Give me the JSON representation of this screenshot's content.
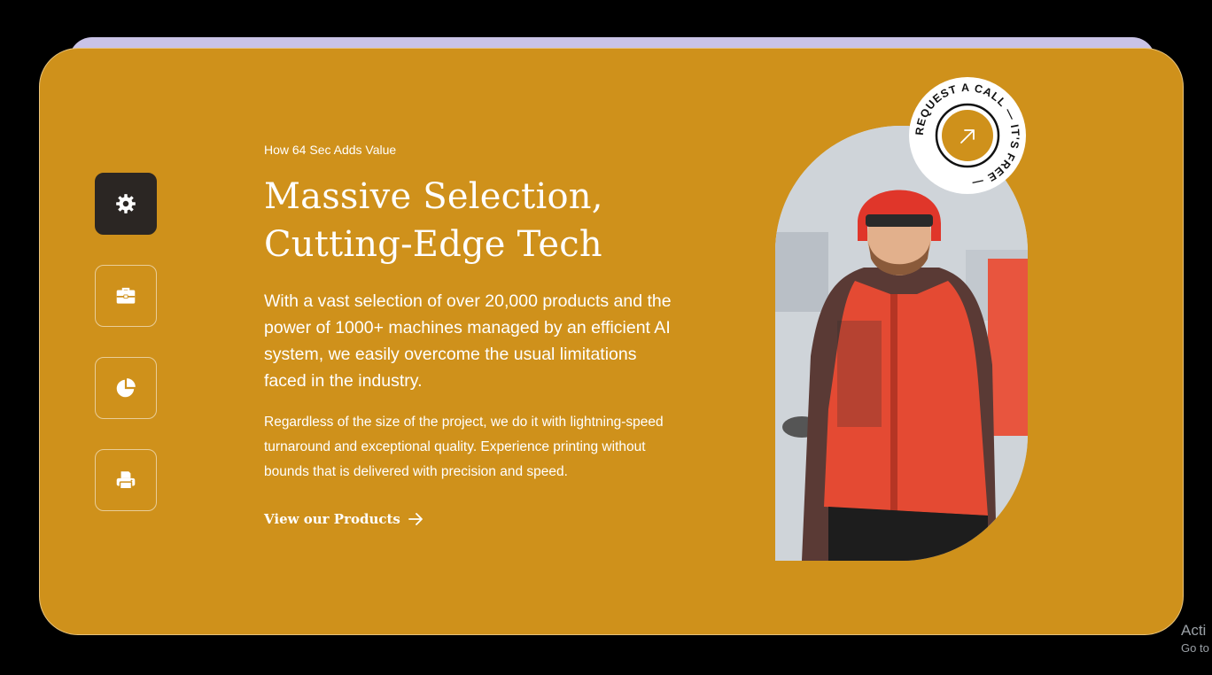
{
  "section": {
    "eyebrow": "How 64 Sec Adds Value",
    "headline_line1": "Massive Selection,",
    "headline_line2": "Cutting-Edge Tech",
    "lead": "With a vast selection of over 20,000 products and the power of 1000+ machines managed by an efficient AI system, we easily overcome the usual limitations faced in the industry.",
    "body": "Regardless of the size of the project, we do it with lightning-speed turnaround and exceptional quality. Experience printing without bounds that is delivered with precision and speed.",
    "cta_label": "View our Products"
  },
  "tabs": [
    {
      "icon": "gear-icon",
      "active": true
    },
    {
      "icon": "briefcase-icon",
      "active": false
    },
    {
      "icon": "pie-chart-icon",
      "active": false
    },
    {
      "icon": "printer-icon",
      "active": false
    }
  ],
  "badge": {
    "text": "REQUEST A CALL — IT'S FREE —",
    "icon": "arrow-up-right-icon"
  },
  "watermark": {
    "line1": "Acti",
    "line2": "Go to"
  },
  "colors": {
    "card_bg": "#cf911b",
    "active_tab_bg": "#2b2623",
    "text": "#ffffff",
    "back_card": "#c9c3e6",
    "page_bg": "#000000"
  }
}
